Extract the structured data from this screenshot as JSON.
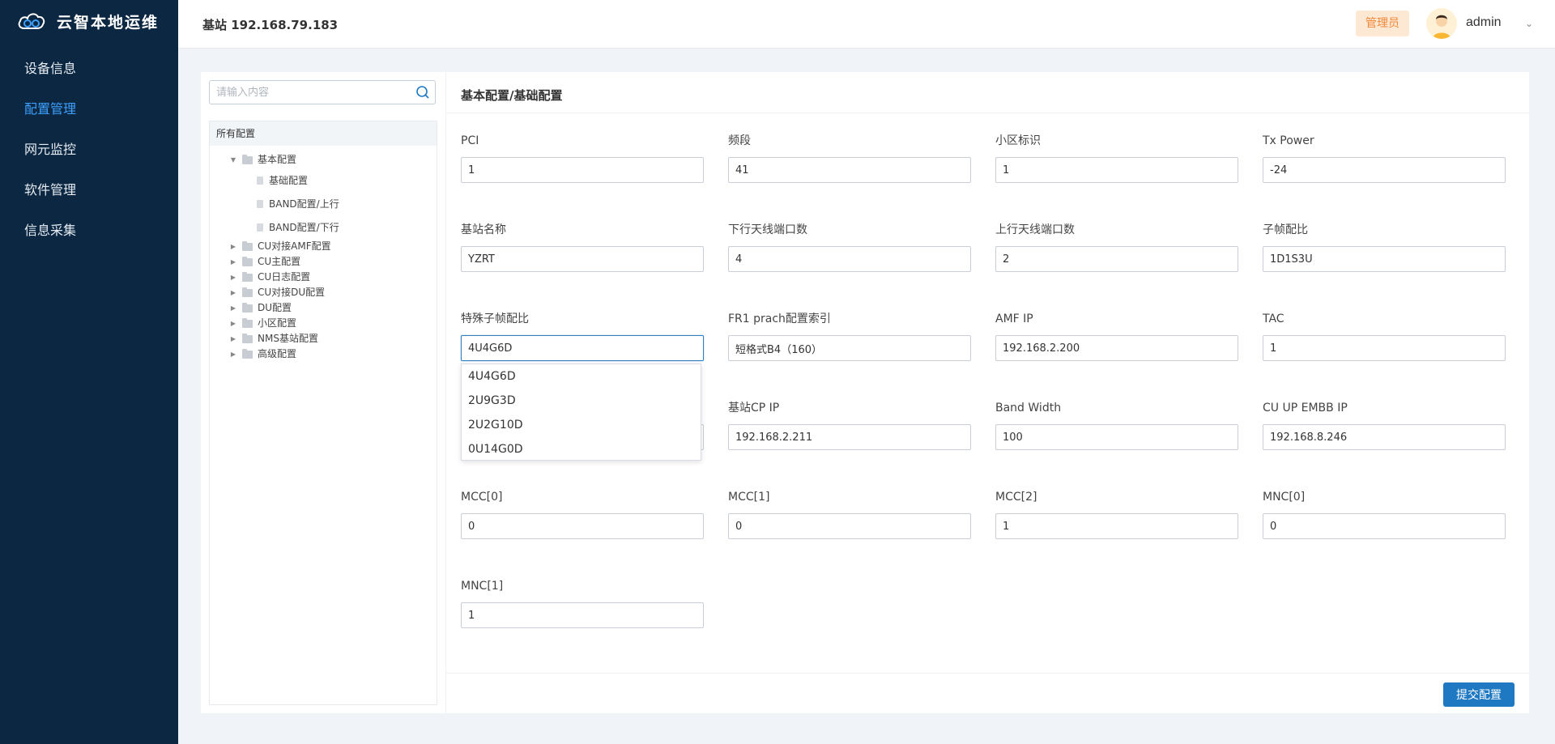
{
  "app": {
    "title": "云智本地运维",
    "accent_color": "#1e78c2",
    "sidebar_bg": "#0b2742",
    "active_color": "#3ea0ff"
  },
  "sidebar": {
    "items": [
      {
        "label": "设备信息",
        "active": false
      },
      {
        "label": "配置管理",
        "active": true
      },
      {
        "label": "网元监控",
        "active": false
      },
      {
        "label": "软件管理",
        "active": false
      },
      {
        "label": "信息采集",
        "active": false
      }
    ]
  },
  "header": {
    "title": "基站 192.168.79.183",
    "role": "管理员",
    "username": "admin",
    "avatar_icon": "user-avatar-icon",
    "menu_icon": "chevron-down-icon"
  },
  "tree": {
    "search_placeholder": "请输入内容",
    "root_label": "所有配置",
    "nodes": [
      {
        "label": "基本配置",
        "expanded": true,
        "children": [
          {
            "label": "基础配置"
          },
          {
            "label": "BAND配置/上行"
          },
          {
            "label": "BAND配置/下行"
          }
        ]
      },
      {
        "label": "CU对接AMF配置",
        "expanded": false
      },
      {
        "label": "CU主配置",
        "expanded": false
      },
      {
        "label": "CU日志配置",
        "expanded": false
      },
      {
        "label": "CU对接DU配置",
        "expanded": false
      },
      {
        "label": "DU配置",
        "expanded": false
      },
      {
        "label": "小区配置",
        "expanded": false
      },
      {
        "label": "NMS基站配置",
        "expanded": false
      },
      {
        "label": "高级配置",
        "expanded": false
      }
    ]
  },
  "form": {
    "breadcrumb": "基本配置/基础配置",
    "fields": [
      {
        "label": "PCI",
        "value": "1"
      },
      {
        "label": "频段",
        "value": "41"
      },
      {
        "label": "小区标识",
        "value": "1"
      },
      {
        "label": "Tx Power",
        "value": "-24"
      },
      {
        "label": "基站名称",
        "value": "YZRT"
      },
      {
        "label": "下行天线端口数",
        "value": "4"
      },
      {
        "label": "上行天线端口数",
        "value": "2"
      },
      {
        "label": "子帧配比",
        "value": "1D1S3U"
      },
      {
        "label": "特殊子帧配比",
        "value": "4U4G6D"
      },
      {
        "label": "FR1 prach配置索引",
        "value": "短格式B4（160）"
      },
      {
        "label": "AMF IP",
        "value": "192.168.2.200"
      },
      {
        "label": "TAC",
        "value": "1"
      },
      {
        "label": "",
        "value": ""
      },
      {
        "label": "基站CP IP",
        "value": "192.168.2.211"
      },
      {
        "label": "Band Width",
        "value": "100"
      },
      {
        "label": "CU UP EMBB IP",
        "value": "192.168.8.246"
      },
      {
        "label": "MCC[0]",
        "value": "0"
      },
      {
        "label": "MCC[1]",
        "value": "0"
      },
      {
        "label": "MCC[2]",
        "value": "1"
      },
      {
        "label": "MNC[0]",
        "value": "0"
      },
      {
        "label": "MNC[1]",
        "value": "1"
      }
    ],
    "dropdown": {
      "open_for": "特殊子帧配比",
      "options": [
        "4U4G6D",
        "2U9G3D",
        "2U2G10D",
        "0U14G0D"
      ]
    },
    "submit_label": "提交配置"
  }
}
